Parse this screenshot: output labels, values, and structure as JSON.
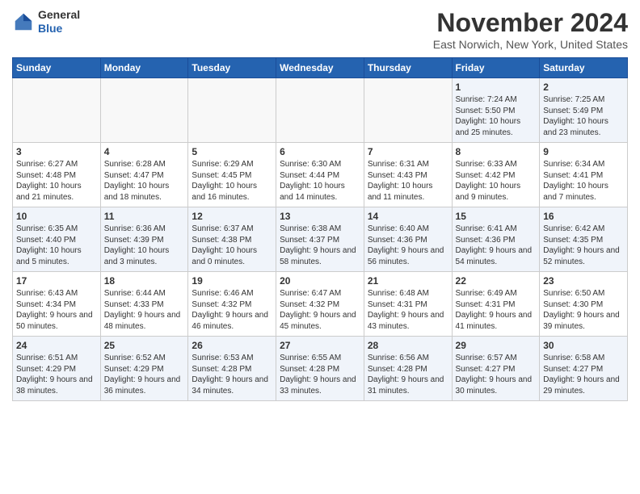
{
  "header": {
    "logo_line1": "General",
    "logo_line2": "Blue",
    "month": "November 2024",
    "location": "East Norwich, New York, United States"
  },
  "weekdays": [
    "Sunday",
    "Monday",
    "Tuesday",
    "Wednesday",
    "Thursday",
    "Friday",
    "Saturday"
  ],
  "weeks": [
    [
      {
        "day": "",
        "info": ""
      },
      {
        "day": "",
        "info": ""
      },
      {
        "day": "",
        "info": ""
      },
      {
        "day": "",
        "info": ""
      },
      {
        "day": "",
        "info": ""
      },
      {
        "day": "1",
        "info": "Sunrise: 7:24 AM\nSunset: 5:50 PM\nDaylight: 10 hours and 25 minutes."
      },
      {
        "day": "2",
        "info": "Sunrise: 7:25 AM\nSunset: 5:49 PM\nDaylight: 10 hours and 23 minutes."
      }
    ],
    [
      {
        "day": "3",
        "info": "Sunrise: 6:27 AM\nSunset: 4:48 PM\nDaylight: 10 hours and 21 minutes."
      },
      {
        "day": "4",
        "info": "Sunrise: 6:28 AM\nSunset: 4:47 PM\nDaylight: 10 hours and 18 minutes."
      },
      {
        "day": "5",
        "info": "Sunrise: 6:29 AM\nSunset: 4:45 PM\nDaylight: 10 hours and 16 minutes."
      },
      {
        "day": "6",
        "info": "Sunrise: 6:30 AM\nSunset: 4:44 PM\nDaylight: 10 hours and 14 minutes."
      },
      {
        "day": "7",
        "info": "Sunrise: 6:31 AM\nSunset: 4:43 PM\nDaylight: 10 hours and 11 minutes."
      },
      {
        "day": "8",
        "info": "Sunrise: 6:33 AM\nSunset: 4:42 PM\nDaylight: 10 hours and 9 minutes."
      },
      {
        "day": "9",
        "info": "Sunrise: 6:34 AM\nSunset: 4:41 PM\nDaylight: 10 hours and 7 minutes."
      }
    ],
    [
      {
        "day": "10",
        "info": "Sunrise: 6:35 AM\nSunset: 4:40 PM\nDaylight: 10 hours and 5 minutes."
      },
      {
        "day": "11",
        "info": "Sunrise: 6:36 AM\nSunset: 4:39 PM\nDaylight: 10 hours and 3 minutes."
      },
      {
        "day": "12",
        "info": "Sunrise: 6:37 AM\nSunset: 4:38 PM\nDaylight: 10 hours and 0 minutes."
      },
      {
        "day": "13",
        "info": "Sunrise: 6:38 AM\nSunset: 4:37 PM\nDaylight: 9 hours and 58 minutes."
      },
      {
        "day": "14",
        "info": "Sunrise: 6:40 AM\nSunset: 4:36 PM\nDaylight: 9 hours and 56 minutes."
      },
      {
        "day": "15",
        "info": "Sunrise: 6:41 AM\nSunset: 4:36 PM\nDaylight: 9 hours and 54 minutes."
      },
      {
        "day": "16",
        "info": "Sunrise: 6:42 AM\nSunset: 4:35 PM\nDaylight: 9 hours and 52 minutes."
      }
    ],
    [
      {
        "day": "17",
        "info": "Sunrise: 6:43 AM\nSunset: 4:34 PM\nDaylight: 9 hours and 50 minutes."
      },
      {
        "day": "18",
        "info": "Sunrise: 6:44 AM\nSunset: 4:33 PM\nDaylight: 9 hours and 48 minutes."
      },
      {
        "day": "19",
        "info": "Sunrise: 6:46 AM\nSunset: 4:32 PM\nDaylight: 9 hours and 46 minutes."
      },
      {
        "day": "20",
        "info": "Sunrise: 6:47 AM\nSunset: 4:32 PM\nDaylight: 9 hours and 45 minutes."
      },
      {
        "day": "21",
        "info": "Sunrise: 6:48 AM\nSunset: 4:31 PM\nDaylight: 9 hours and 43 minutes."
      },
      {
        "day": "22",
        "info": "Sunrise: 6:49 AM\nSunset: 4:31 PM\nDaylight: 9 hours and 41 minutes."
      },
      {
        "day": "23",
        "info": "Sunrise: 6:50 AM\nSunset: 4:30 PM\nDaylight: 9 hours and 39 minutes."
      }
    ],
    [
      {
        "day": "24",
        "info": "Sunrise: 6:51 AM\nSunset: 4:29 PM\nDaylight: 9 hours and 38 minutes."
      },
      {
        "day": "25",
        "info": "Sunrise: 6:52 AM\nSunset: 4:29 PM\nDaylight: 9 hours and 36 minutes."
      },
      {
        "day": "26",
        "info": "Sunrise: 6:53 AM\nSunset: 4:28 PM\nDaylight: 9 hours and 34 minutes."
      },
      {
        "day": "27",
        "info": "Sunrise: 6:55 AM\nSunset: 4:28 PM\nDaylight: 9 hours and 33 minutes."
      },
      {
        "day": "28",
        "info": "Sunrise: 6:56 AM\nSunset: 4:28 PM\nDaylight: 9 hours and 31 minutes."
      },
      {
        "day": "29",
        "info": "Sunrise: 6:57 AM\nSunset: 4:27 PM\nDaylight: 9 hours and 30 minutes."
      },
      {
        "day": "30",
        "info": "Sunrise: 6:58 AM\nSunset: 4:27 PM\nDaylight: 9 hours and 29 minutes."
      }
    ]
  ]
}
